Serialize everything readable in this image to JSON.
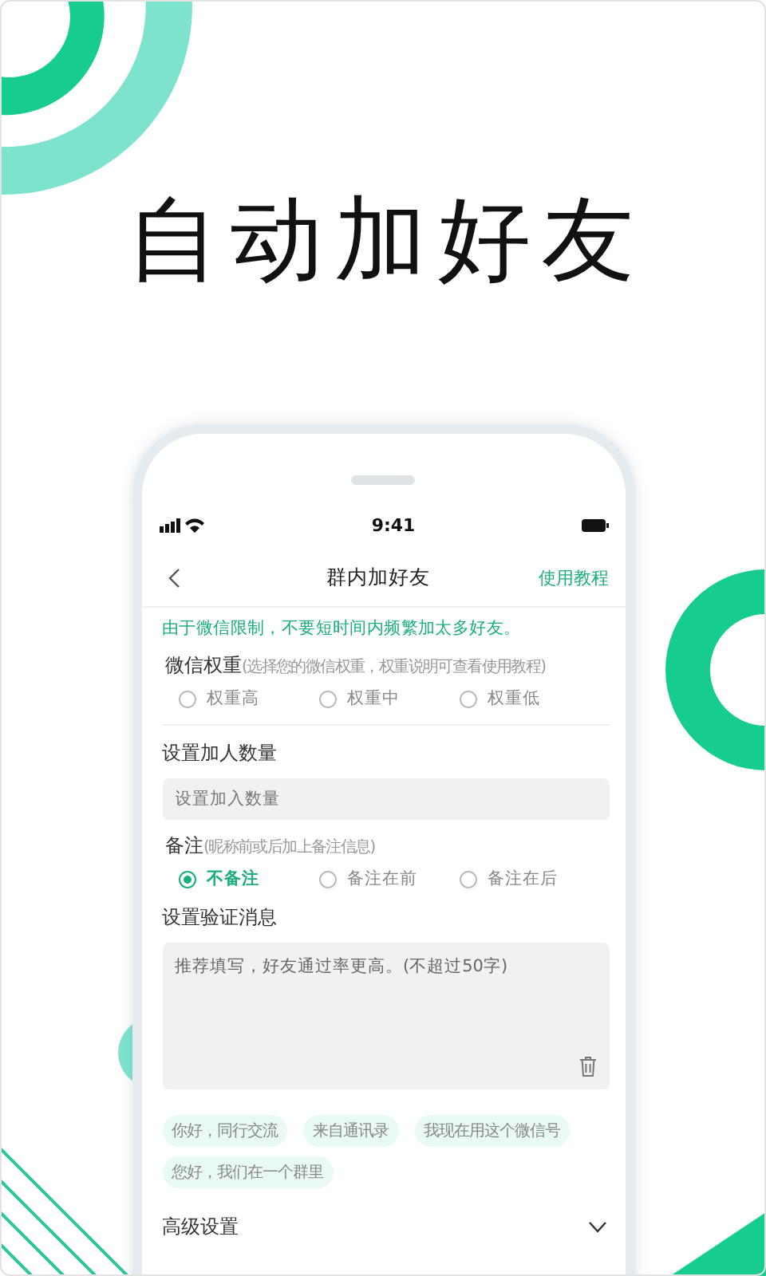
{
  "headline": "自动加好友",
  "status_bar": {
    "time": "9:41"
  },
  "nav": {
    "title": "群内加好友",
    "action": "使用教程"
  },
  "notice": "由于微信限制，不要短时间内频繁加太多好友。",
  "weight": {
    "label": "微信权重",
    "hint": "(选择您的微信权重，权重说明可查看使用教程)",
    "options": [
      {
        "label": "权重高",
        "selected": false
      },
      {
        "label": "权重中",
        "selected": false
      },
      {
        "label": "权重低",
        "selected": false
      }
    ]
  },
  "count": {
    "label": "设置加人数量",
    "placeholder": "设置加入数量"
  },
  "remark": {
    "label": "备注",
    "hint": "(昵称前或后加上备注信息)",
    "options": [
      {
        "label": "不备注",
        "selected": true
      },
      {
        "label": "备注在前",
        "selected": false
      },
      {
        "label": "备注在后",
        "selected": false
      }
    ]
  },
  "message": {
    "label": "设置验证消息",
    "placeholder": "推荐填写，好友通过率更高。(不超过50字)"
  },
  "templates": [
    "你好，同行交流",
    "来自通讯录",
    "我现在用这个微信号",
    "您好，我们在一个群里"
  ],
  "advanced": {
    "label": "高级设置"
  }
}
